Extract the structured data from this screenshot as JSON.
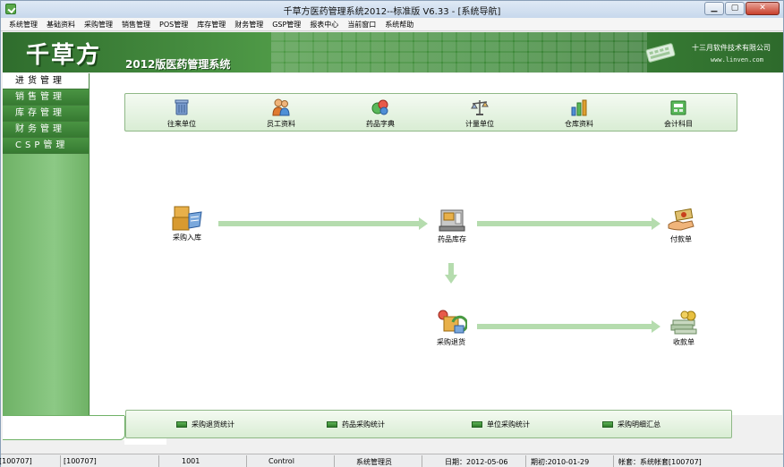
{
  "window": {
    "title": "千草方医药管理系统2012--标准版 V6.33 - [系统导航]",
    "buttons": [
      "▁",
      "▢",
      "✕"
    ]
  },
  "menu": [
    "系统管理",
    "基础资料",
    "采购管理",
    "销售管理",
    "POS管理",
    "库存管理",
    "财务管理",
    "GSP管理",
    "报表中心",
    "当前窗口",
    "系统帮助"
  ],
  "banner": {
    "logo": "千草方",
    "subtitle": "2012版医药管理系统",
    "company": "十三月软件技术有限公司",
    "website": "www.linven.com"
  },
  "nav": [
    {
      "label": "进货管理",
      "active": true
    },
    {
      "label": "销售管理",
      "active": false
    },
    {
      "label": "库存管理",
      "active": false
    },
    {
      "label": "财务管理",
      "active": false
    },
    {
      "label": "CSP管理",
      "active": false
    }
  ],
  "toolbar": [
    {
      "label": "往来单位",
      "icon": "trash-bin-icon"
    },
    {
      "label": "员工资料",
      "icon": "people-icon"
    },
    {
      "label": "药品字典",
      "icon": "pills-icon"
    },
    {
      "label": "计量单位",
      "icon": "scale-icon"
    },
    {
      "label": "仓库资料",
      "icon": "warehouse-icon"
    },
    {
      "label": "会计科目",
      "icon": "ledger-icon"
    }
  ],
  "flow": {
    "purchase_in": {
      "label": "采购入库",
      "icon": "boxes-icon"
    },
    "stock": {
      "label": "药品库存",
      "icon": "register-icon"
    },
    "payment": {
      "label": "付款单",
      "icon": "cash-hand-icon"
    },
    "purchase_return": {
      "label": "采购退货",
      "icon": "return-box-icon"
    },
    "receipt": {
      "label": "收款单",
      "icon": "money-stack-icon"
    }
  },
  "reports": [
    "采购退货统计",
    "药品采购统计",
    "单位采购统计",
    "采购明细汇总"
  ],
  "status": {
    "code1": "[100707]",
    "code2": "[100707]",
    "user_id": "1001",
    "control": "Control",
    "role": "系统管理员",
    "date": "日期：2012-05-06",
    "period_start": "期初:2010-01-29",
    "account": "帐套：系统帐套[100707]"
  }
}
